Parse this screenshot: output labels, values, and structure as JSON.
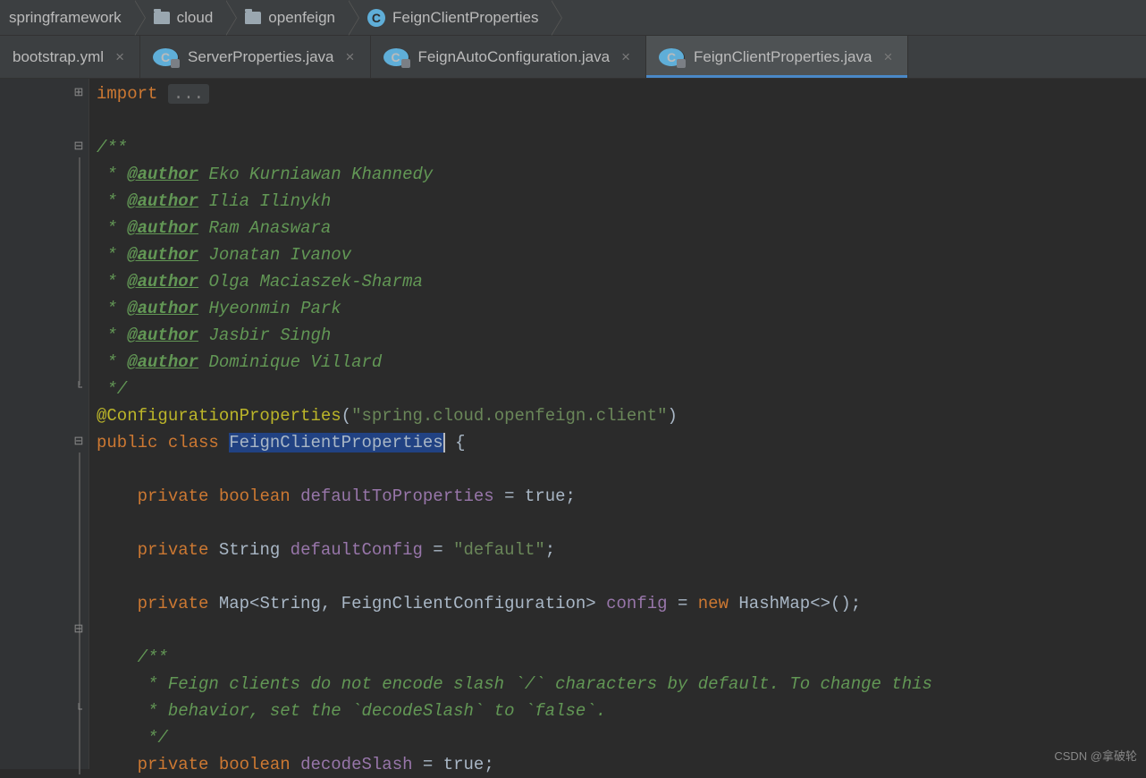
{
  "breadcrumbs": [
    {
      "label": "springframework",
      "icon": "folder"
    },
    {
      "label": "cloud",
      "icon": "folder"
    },
    {
      "label": "openfeign",
      "icon": "folder"
    },
    {
      "label": "FeignClientProperties",
      "icon": "class"
    }
  ],
  "tabs": [
    {
      "label": "bootstrap.yml",
      "close": "×",
      "active": false
    },
    {
      "label": "ServerProperties.java",
      "close": "×",
      "active": false
    },
    {
      "label": "FeignAutoConfiguration.java",
      "close": "×",
      "active": false
    },
    {
      "label": "FeignClientProperties.java",
      "close": "×",
      "active": true
    }
  ],
  "code": {
    "import_kw": "import",
    "ellipsis": "...",
    "doc_open": "/**",
    "doc_star": " *",
    "authors": [
      "Eko Kurniawan Khannedy",
      "Ilia Ilinykh",
      "Ram Anaswara",
      "Jonatan Ivanov",
      "Olga Maciaszek-Sharma",
      "Hyeonmin Park",
      "Jasbir Singh",
      "Dominique Villard"
    ],
    "author_tag": "@author",
    "doc_close": " */",
    "annotation": "@ConfigurationProperties",
    "annotation_value": "\"spring.cloud.openfeign.client\"",
    "kw_public": "public",
    "kw_class": "class",
    "class_name": "FeignClientProperties",
    "brace_open": " {",
    "kw_private": "private",
    "kw_boolean": "boolean",
    "kw_new": "new",
    "field1": "defaultToProperties",
    "field1_val": " = true;",
    "type_string": "String",
    "field2": "defaultConfig",
    "field2_val": " = ",
    "field2_str": "\"default\"",
    "semi": ";",
    "type_map": "Map<String, FeignClientConfiguration>",
    "field3": "config",
    "hashmap": " HashMap<>();",
    "doc2_l1": " * Feign clients do not encode slash `/` characters by default. To change this",
    "doc2_l2": " * behavior, set the `decodeSlash` to `false`.",
    "field4": "decodeSlash",
    "field4_val": " = true;"
  },
  "watermark": "CSDN @拿破轮",
  "class_letter": "C"
}
